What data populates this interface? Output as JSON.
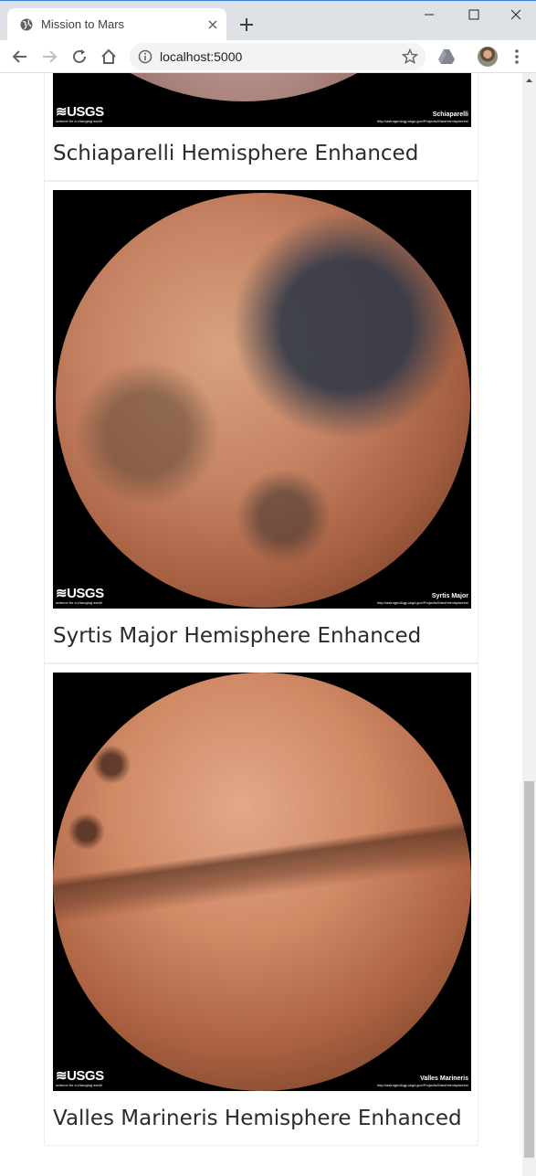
{
  "browser": {
    "tab_title": "Mission to Mars",
    "url": "localhost:5000"
  },
  "hemispheres": [
    {
      "title": "Schiaparelli Hemisphere Enhanced",
      "usgs_logo": "≋USGS",
      "usgs_tagline": "science for a changing world",
      "image_label": "Schiaparelli",
      "source_url": "http://astrogeology.usgs.gov/Projects/MarsHemispheres/"
    },
    {
      "title": "Syrtis Major Hemisphere Enhanced",
      "usgs_logo": "≋USGS",
      "usgs_tagline": "science for a changing world",
      "image_label": "Syrtis Major",
      "source_url": "http://astrogeology.usgs.gov/Projects/MarsHemispheres/"
    },
    {
      "title": "Valles Marineris Hemisphere Enhanced",
      "usgs_logo": "≋USGS",
      "usgs_tagline": "science for a changing world",
      "image_label": "Valles Marineris",
      "source_url": "http://astrogeology.usgs.gov/Projects/MarsHemispheres/"
    }
  ],
  "icons": [
    "globe-icon",
    "close-icon",
    "plus-icon",
    "minimize-icon",
    "maximize-icon",
    "back-icon",
    "forward-icon",
    "reload-icon",
    "home-icon",
    "info-icon",
    "star-icon",
    "drive-icon",
    "kebab-menu-icon"
  ]
}
